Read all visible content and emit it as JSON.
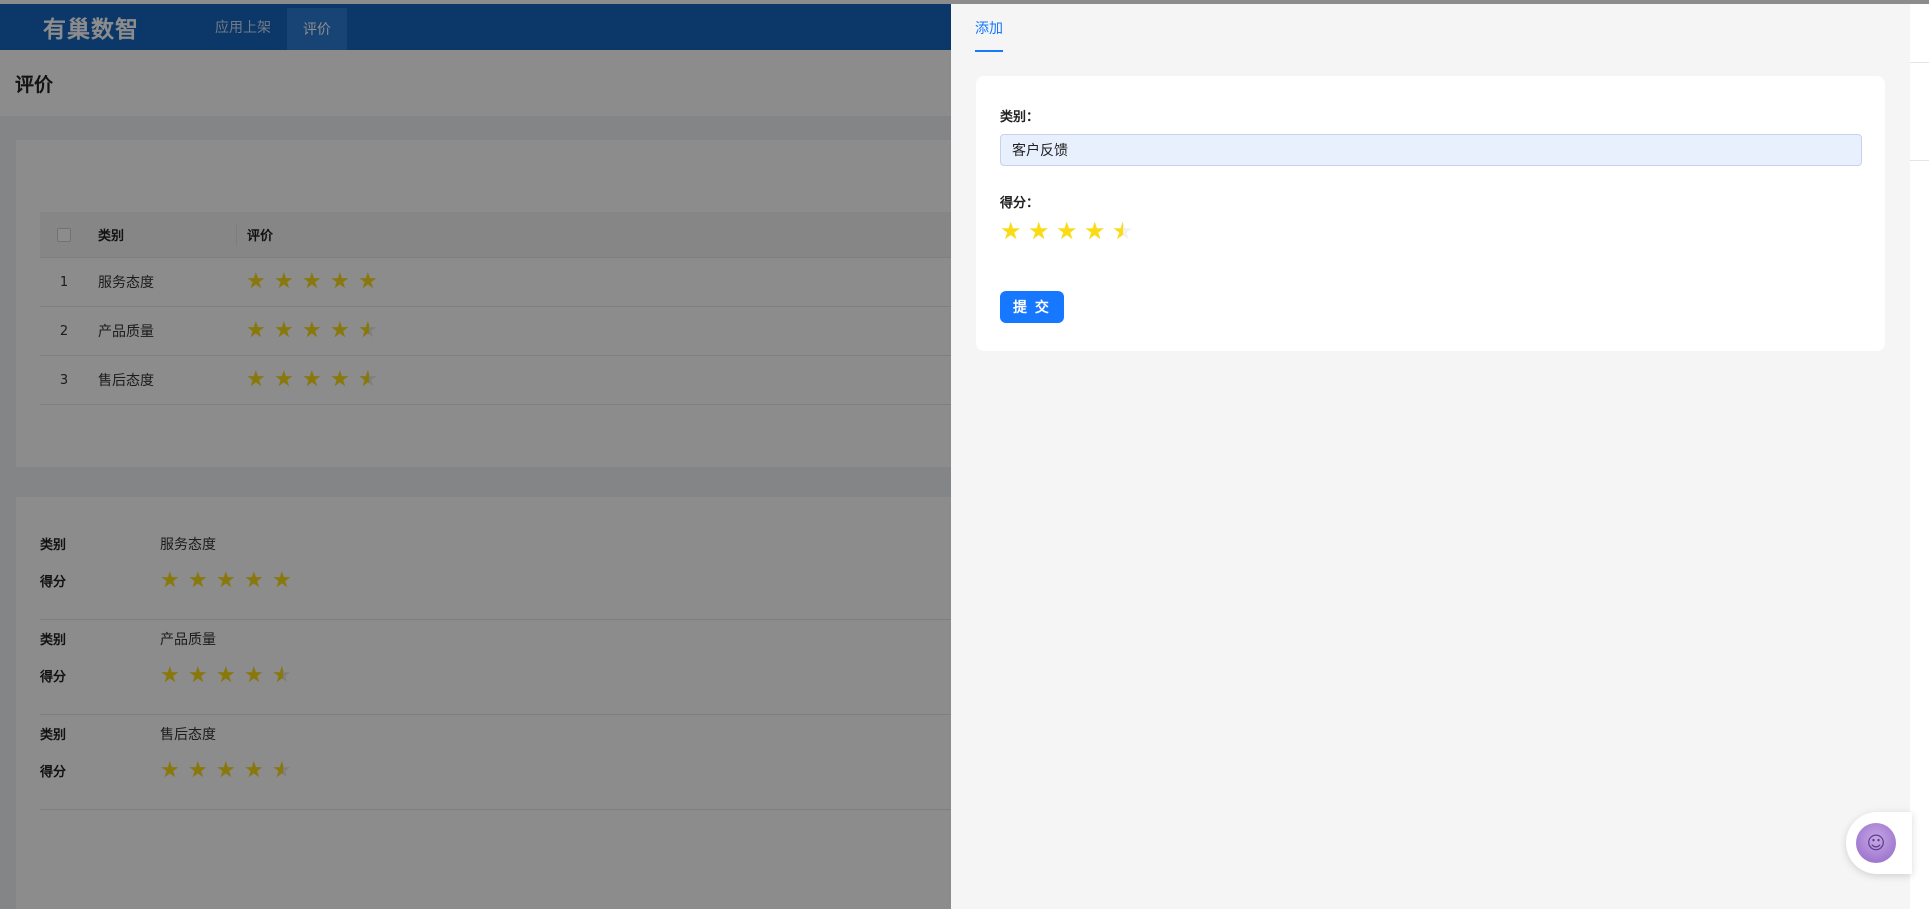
{
  "header": {
    "logo": "有巢数智",
    "nav": [
      {
        "label": "应用上架",
        "active": false
      },
      {
        "label": "评价",
        "active": true
      }
    ]
  },
  "page": {
    "title": "评价"
  },
  "table": {
    "columns": [
      "类别",
      "评价"
    ],
    "rows": [
      {
        "index": "1",
        "category": "服务态度",
        "rating": 5
      },
      {
        "index": "2",
        "category": "产品质量",
        "rating": 4.5
      },
      {
        "index": "3",
        "category": "售后态度",
        "rating": 4.5
      }
    ]
  },
  "descriptions": [
    {
      "category_label": "类别",
      "category": "服务态度",
      "score_label": "得分",
      "rating": 5
    },
    {
      "category_label": "类别",
      "category": "产品质量",
      "score_label": "得分",
      "rating": 4.5
    },
    {
      "category_label": "类别",
      "category": "售后态度",
      "score_label": "得分",
      "rating": 4.5
    }
  ],
  "drawer": {
    "tab": "添加",
    "form": {
      "category_label": "类别：",
      "category_value": "客户反馈",
      "score_label": "得分：",
      "score_value": 4.5,
      "submit_label": "提 交"
    }
  },
  "colors": {
    "header_bg": "#1565c0",
    "primary": "#1677ff",
    "star": "#fadb14"
  },
  "icons": {
    "star": "star-icon",
    "customer_service": "customer-service-icon"
  }
}
